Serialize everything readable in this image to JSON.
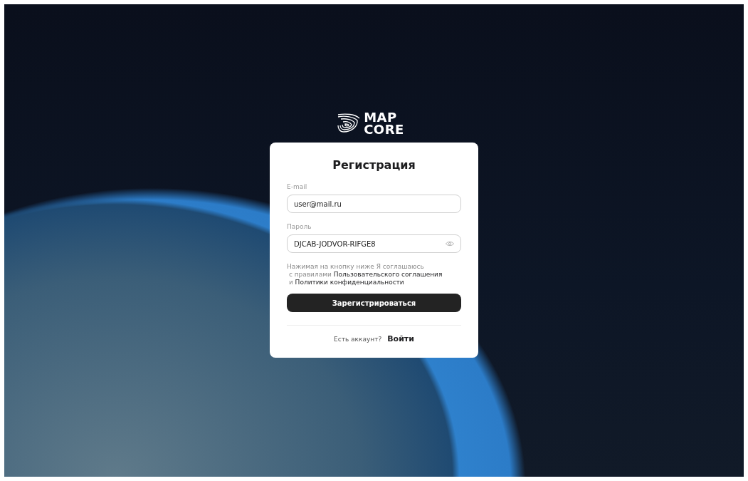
{
  "logo": {
    "lines": [
      "MAP",
      "CORE"
    ]
  },
  "form": {
    "title": "Регистрация",
    "fields": [
      {
        "label": "E-mail",
        "value": "user@mail.ru",
        "kind": "text"
      },
      {
        "label": "Пароль",
        "value": "DJCAB-JODVOR-RIFGE8",
        "kind": "password"
      }
    ],
    "agreement": [
      {
        "text": "Нажимая на кнопку ниже Я соглашаюсь"
      },
      {
        "text": "с правилами",
        "link": "Пользовательского соглашения"
      },
      {
        "text": "и",
        "link": "Политики конфиденциальности"
      }
    ],
    "submit": "Зарегистрироваться",
    "footer": {
      "question": "Есть аккаунт?",
      "link": "Войти"
    }
  }
}
